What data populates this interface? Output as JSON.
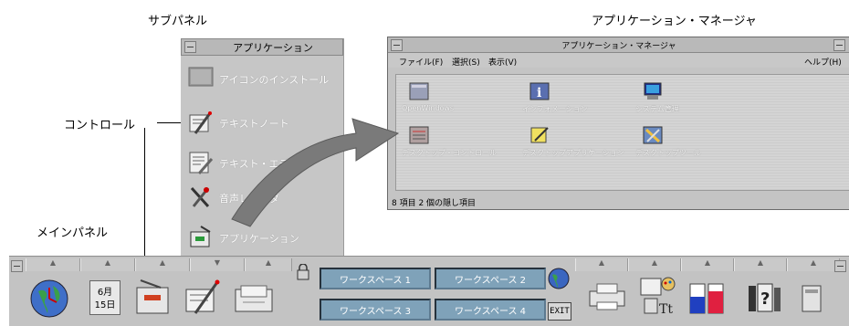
{
  "callouts": {
    "subpanel": "サブパネル",
    "control": "コントロール",
    "main_panel": "メインパネル",
    "app_manager": "アプリケーション・マネージャ"
  },
  "subpanel": {
    "title": "アプリケーション",
    "items": [
      {
        "label": "アイコンのインストール",
        "icon": "drop-zone-icon"
      },
      {
        "label": "テキストノート",
        "icon": "text-note-icon"
      },
      {
        "label": "テキスト・エディタ",
        "icon": "text-editor-icon"
      },
      {
        "label": "音声レコーダ",
        "icon": "audio-icon"
      },
      {
        "label": "アプリケーション",
        "icon": "app-manager-icon"
      }
    ]
  },
  "app_manager": {
    "title": "アプリケーション・マネージャ",
    "menu": {
      "file": "ファイル(F)",
      "select": "選択(S)",
      "view": "表示(V)",
      "help": "ヘルプ(H)"
    },
    "icons": [
      {
        "label": "OpenWindows",
        "icon": "openwindows-icon"
      },
      {
        "label": "インフォメーション",
        "icon": "information-icon"
      },
      {
        "label": "システム管理",
        "icon": "system-admin-icon"
      },
      {
        "label": "デスクトップ・コントロール",
        "icon": "desktop-control-icon"
      },
      {
        "label": "デスクトップアプリケーション",
        "icon": "desktop-apps-icon"
      },
      {
        "label": "デスクトップツール",
        "icon": "desktop-tools-icon"
      }
    ],
    "status": "8 項目 2 個の隠し項目"
  },
  "main_panel": {
    "calendar": {
      "month": "6月",
      "day": "15日"
    },
    "workspaces": [
      "ワークスペース 1",
      "ワークスペース 2",
      "ワークスペース 3",
      "ワークスペース 4"
    ],
    "exit": "EXIT"
  },
  "colors": {
    "panel_gray": "#c3c3c3",
    "workspace_blue": "#7fa2b9",
    "arrow_gray": "#7a7a7a"
  }
}
